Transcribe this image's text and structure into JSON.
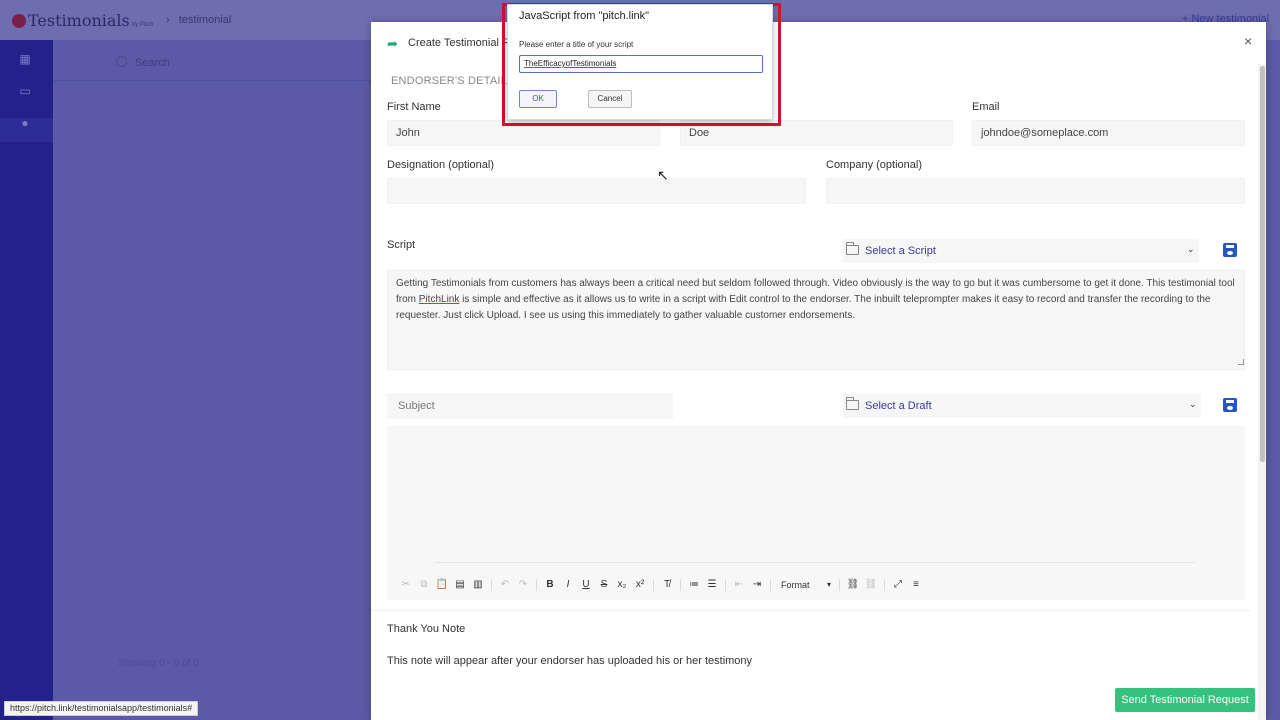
{
  "app": {
    "logo_text": "Testimonials",
    "logo_sub": "by Pitch",
    "breadcrumb_sep": "›",
    "breadcrumb": "testimonial",
    "new_link": "+ New testimonial",
    "search_placeholder": "Search",
    "showing_text": "Showing 0 - 0 of 0"
  },
  "modal": {
    "title": "Create Testimonial R",
    "close_glyph": "×",
    "section_label": "ENDORSER'S DETAILS",
    "first_name_label": "First Name",
    "first_name_value": "John",
    "last_name_value": "Doe",
    "email_label": "Email",
    "email_value": "johndoe@someplace.com",
    "designation_label": "Designation (optional)",
    "company_label": "Company (optional)",
    "script_label": "Script",
    "select_script": "Select a Script",
    "script_text_1": "Getting Testimonials from customers has always been a critical need but seldom followed through. Video obviously is the way to go but it was cumbersome to get it done. This testimonial tool from ",
    "script_text_link": "PitchLink",
    "script_text_2": " is simple and effective as it allows us to write in a script with Edit control to the endorser. The inbuilt teleprompter makes it easy to record and transfer the recording to the requester. Just click Upload. I see us using this immediately to gather valuable customer endorsements.",
    "subject_placeholder": "Subject",
    "select_draft": "Select a Draft",
    "format_label": "Format",
    "thanks_label": "Thank You Note",
    "note_text": "This note will appear after your endorser has uploaded his or her testimony",
    "send_button": "Send Testimonial Request"
  },
  "status_url": "https://pitch.link/testimonialsapp/testimonials#",
  "dialog": {
    "title": "JavaScript from \"pitch.link\"",
    "message": "Please enter a title of your script",
    "input_value": "TheEfficacyofTestimonials",
    "ok": "OK",
    "cancel": "Cancel"
  },
  "colors": {
    "accent": "#2456c9",
    "send_green": "#35c27c",
    "sidebar": "#24228a",
    "highlight_outline": "#d4122d"
  }
}
